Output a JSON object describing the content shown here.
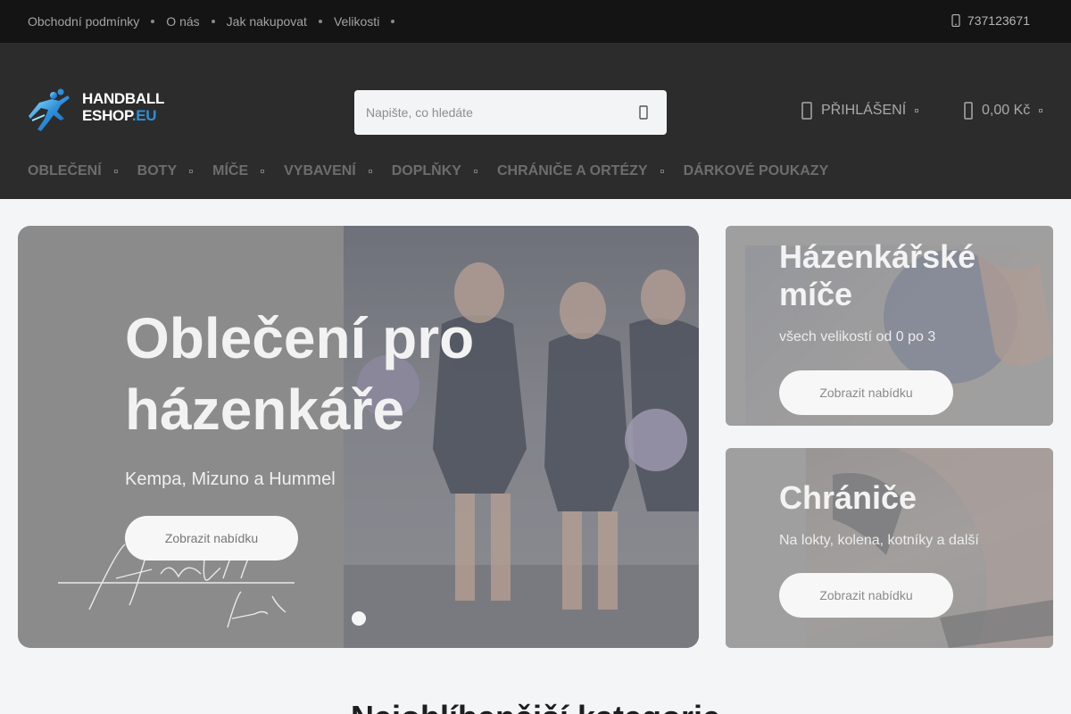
{
  "topbar": {
    "links": [
      "Obchodní podmínky",
      "O nás",
      "Jak nakupovat",
      "Velikosti"
    ],
    "phone": "737123671"
  },
  "header": {
    "logo": {
      "line1": "HANDBALL",
      "line2": "ESHOP",
      "line2_suffix": ".EU"
    },
    "search_placeholder": "Napište, co hledáte",
    "login_label": "PŘIHLÁŠENÍ",
    "cart_total": "0,00 Kč"
  },
  "nav": {
    "items": [
      "OBLEČENÍ",
      "BOTY",
      "MÍČE",
      "VYBAVENÍ",
      "DOPLŇKY",
      "CHRÁNIČE A ORTÉZY",
      "DÁRKOVÉ POUKAZY"
    ]
  },
  "hero": {
    "title": "Oblečení pro házenkáře",
    "subtitle": "Kempa, Mizuno a Hummel",
    "button": "Zobrazit nabídku",
    "active_slide": 1,
    "slide_count": 1
  },
  "banners": [
    {
      "title": "Házenkářské míče",
      "subtitle": "všech velikostí od 0 po 3",
      "button": "Zobrazit nabídku"
    },
    {
      "title": "Chrániče",
      "subtitle": "Na lokty, kolena, kotníky a další",
      "button": "Zobrazit nabídku"
    }
  ],
  "section": {
    "title": "Nejoblíbenější kategorie"
  },
  "icons": {
    "phone": "phone-icon",
    "search": "search-icon",
    "user": "user-icon",
    "cart": "shopping-bag-icon"
  },
  "colors": {
    "topbar_bg": "#141414",
    "header_bg": "#2c2c2c",
    "brand_blue": "#2f8fd8",
    "page_bg": "#f4f5f7"
  }
}
